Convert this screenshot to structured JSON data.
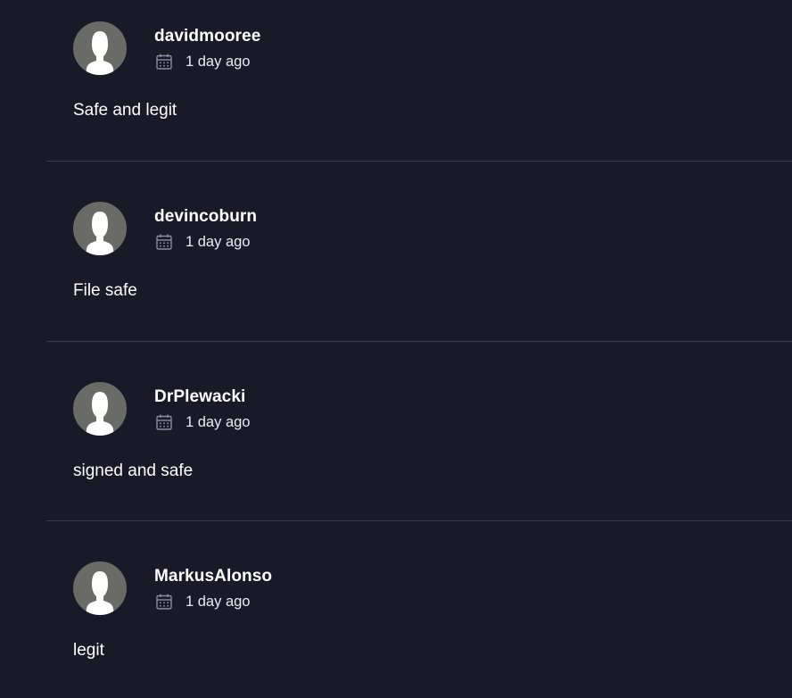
{
  "comments": [
    {
      "username": "davidmooree",
      "time": "1 day ago",
      "text": "Safe and legit"
    },
    {
      "username": "devincoburn",
      "time": "1 day ago",
      "text": "File safe"
    },
    {
      "username": "DrPlewacki",
      "time": "1 day ago",
      "text": "signed and safe"
    },
    {
      "username": "MarkusAlonso",
      "time": "1 day ago",
      "text": "legit"
    }
  ],
  "icons": {
    "avatar": "default-user-silhouette-icon",
    "date": "calendar-icon"
  },
  "colors": {
    "background": "#1a1928",
    "divider": "#3d3c4e",
    "avatar_bg": "#6a6b66",
    "text": "#ffffff",
    "icon": "#8d8ca4"
  }
}
